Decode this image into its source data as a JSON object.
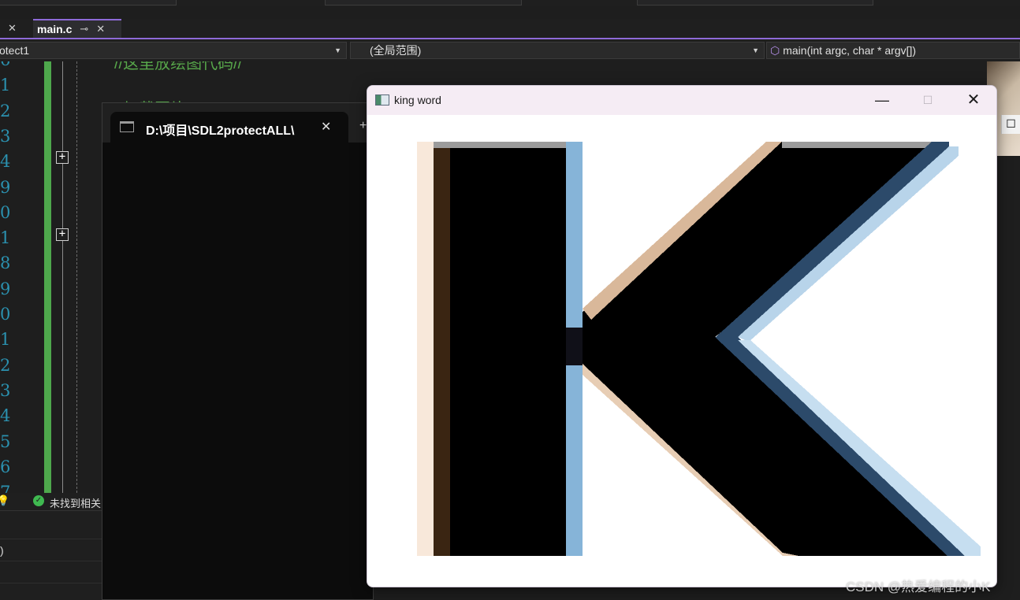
{
  "editor": {
    "tabs": [
      {
        "label": "",
        "close": "✕"
      },
      {
        "label": "main.c",
        "pin": "⊸",
        "close": "✕"
      }
    ],
    "nav": {
      "project": "otect1",
      "scope": "(全局范围)",
      "function": "main(int argc, char * argv[])"
    },
    "line_numbers": [
      "6",
      "1",
      "2",
      "3",
      "4",
      "9",
      "0",
      "1",
      "8",
      "9",
      "0",
      "1",
      "2",
      "3",
      "4",
      "5",
      "6",
      "7"
    ],
    "fold_toggle": "+",
    "comments": [
      "//这里放绘图代码//",
      "//加载图片"
    ],
    "status": {
      "message": "未找到相关问题"
    },
    "output_rows": [
      "",
      ")",
      ""
    ]
  },
  "console": {
    "tab_title": "D:\\项目\\SDL2protectALL\\",
    "close": "✕",
    "new_tab": "+"
  },
  "sdl_window": {
    "title": "king word",
    "minimize": "—",
    "maximize": "☐",
    "close": "✕",
    "image": "pixelated letter K (black fill, blue and tan edges) on white"
  },
  "watermark": "CSDN @热爱编程的小K",
  "colors": {
    "accent": "#8e6ad8",
    "gutter_bar": "#4ea84c",
    "line_number": "#2b91af",
    "comment": "#57a64a",
    "k_fill": "#000000",
    "k_edge_blue": "#86b4d8",
    "k_edge_tan": "#f8e8da",
    "k_edge_brown": "#3a2512"
  }
}
